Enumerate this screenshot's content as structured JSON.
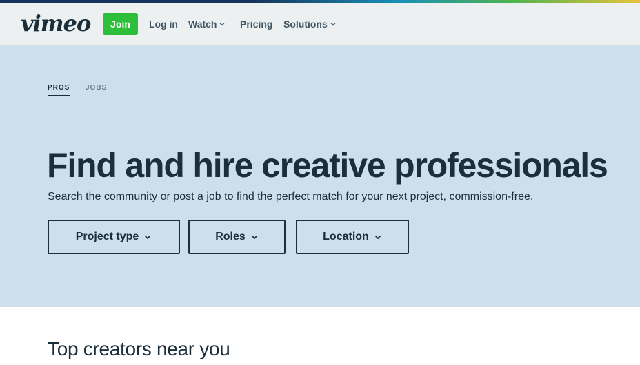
{
  "navbar": {
    "logo": "vimeo",
    "join_label": "Join",
    "login_label": "Log in",
    "watch_label": "Watch",
    "pricing_label": "Pricing",
    "solutions_label": "Solutions"
  },
  "hero": {
    "tabs": [
      {
        "label": "PROS",
        "active": true
      },
      {
        "label": "JOBS",
        "active": false
      }
    ],
    "title": "Find and hire creative professionals",
    "subtitle": "Search the community or post a job to find the perfect match for your next project, commission-free.",
    "filters": [
      {
        "label": "Project type",
        "icon": "chevron-down-icon"
      },
      {
        "label": "Roles",
        "icon": "chevron-down-icon"
      },
      {
        "label": "Location",
        "icon": "chevron-down-icon"
      }
    ]
  },
  "section": {
    "title": "Top creators near you"
  },
  "colors": {
    "join_green": "#2dbe3a",
    "hero_bg": "#cddfeb",
    "nav_bg": "#ecf0f1",
    "text_dark": "#1a2e3b"
  }
}
